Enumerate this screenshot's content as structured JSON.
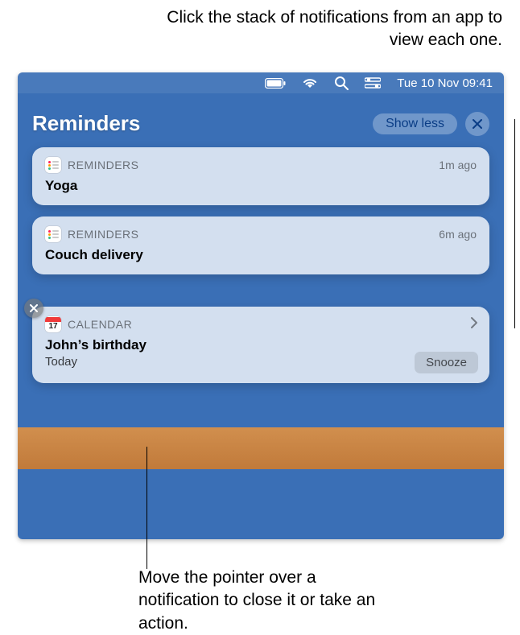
{
  "callouts": {
    "top": "Click the stack of notifications from an app to view each one.",
    "bottom": "Move the pointer over a notification to close it or take an action."
  },
  "menubar": {
    "datetime": "Tue 10 Nov  09:41"
  },
  "group": {
    "title": "Reminders",
    "show_less_label": "Show less"
  },
  "notifications": {
    "reminders": [
      {
        "app": "REMINDERS",
        "time": "1m ago",
        "title": "Yoga"
      },
      {
        "app": "REMINDERS",
        "time": "6m ago",
        "title": "Couch delivery"
      }
    ],
    "calendar": {
      "app": "CALENDAR",
      "title": "John’s birthday",
      "subtitle": "Today",
      "snooze_label": "Snooze",
      "icon_day": "17"
    }
  }
}
